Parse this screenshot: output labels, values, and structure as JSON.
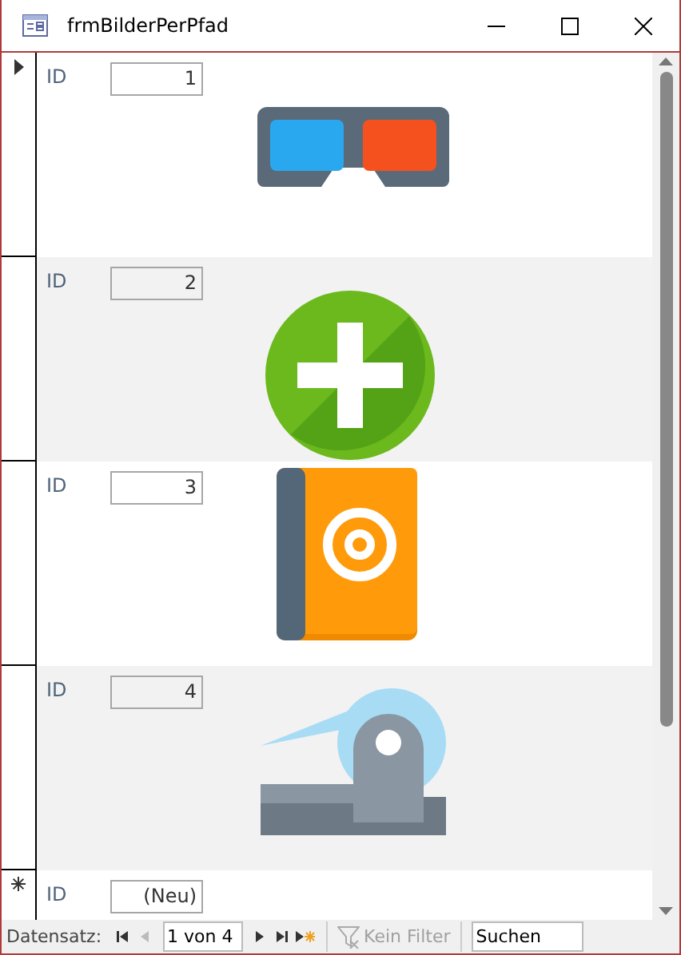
{
  "window": {
    "title": "frmBilderPerPfad"
  },
  "records": [
    {
      "label": "ID",
      "id": "1",
      "current": true,
      "kind": "picture"
    },
    {
      "label": "ID",
      "id": "2",
      "current": false,
      "kind": "picture"
    },
    {
      "label": "ID",
      "id": "3",
      "current": false,
      "kind": "picture"
    },
    {
      "label": "ID",
      "id": "4",
      "current": false,
      "kind": "picture"
    }
  ],
  "new_record": {
    "label": "ID",
    "value": "(Neu)"
  },
  "navigation": {
    "label": "Datensatz:",
    "position": "1 von 4",
    "filter": "Kein Filter",
    "search": "Suchen"
  }
}
